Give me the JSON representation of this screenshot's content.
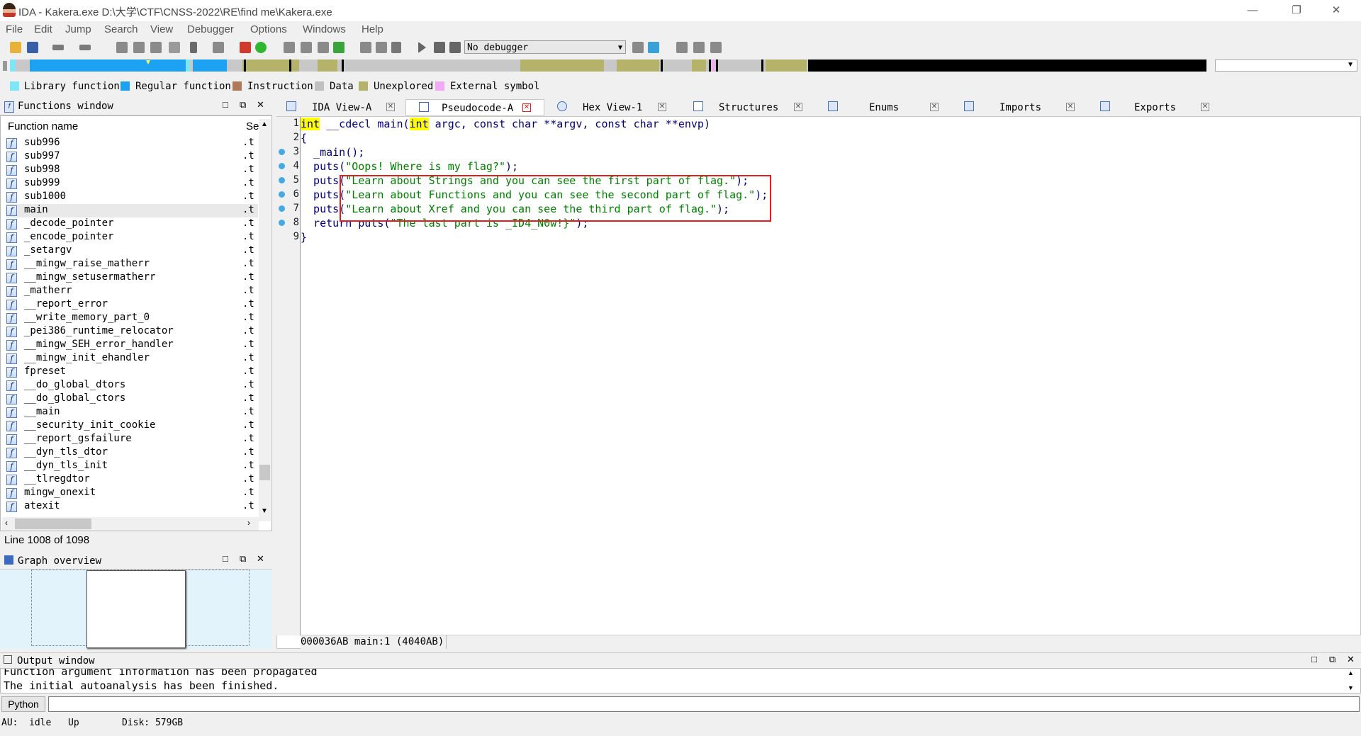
{
  "window": {
    "title": "IDA - Kakera.exe D:\\大学\\CTF\\CNSS-2022\\RE\\find me\\Kakera.exe",
    "minimize": "—",
    "restore": "❐",
    "close": "✕"
  },
  "menu": [
    "File",
    "Edit",
    "Jump",
    "Search",
    "View",
    "Debugger",
    "Options",
    "Windows",
    "Help"
  ],
  "toolbar": {
    "debugger_select": "No debugger"
  },
  "legend": [
    {
      "label": "Library function",
      "color": "#7ee7f7"
    },
    {
      "label": "Regular function",
      "color": "#1da1f2"
    },
    {
      "label": "Instruction",
      "color": "#b07a58"
    },
    {
      "label": "Data",
      "color": "#c0c0c0"
    },
    {
      "label": "Unexplored",
      "color": "#b5b36a"
    },
    {
      "label": "External symbol",
      "color": "#f4a9f4"
    }
  ],
  "functions_window": {
    "title": "Functions window",
    "col_name": "Function name",
    "col_segment": "Se",
    "rows": [
      {
        "name": "sub996",
        "seg": ".t"
      },
      {
        "name": "sub997",
        "seg": ".t"
      },
      {
        "name": "sub998",
        "seg": ".t"
      },
      {
        "name": "sub999",
        "seg": ".t"
      },
      {
        "name": "sub1000",
        "seg": ".t"
      },
      {
        "name": "main",
        "seg": ".t"
      },
      {
        "name": "_decode_pointer",
        "seg": ".t"
      },
      {
        "name": "_encode_pointer",
        "seg": ".t"
      },
      {
        "name": "_setargv",
        "seg": ".t"
      },
      {
        "name": "__mingw_raise_matherr",
        "seg": ".t"
      },
      {
        "name": "__mingw_setusermatherr",
        "seg": ".t"
      },
      {
        "name": "_matherr",
        "seg": ".t"
      },
      {
        "name": "__report_error",
        "seg": ".t"
      },
      {
        "name": "__write_memory_part_0",
        "seg": ".t"
      },
      {
        "name": "_pei386_runtime_relocator",
        "seg": ".t"
      },
      {
        "name": "__mingw_SEH_error_handler",
        "seg": ".t"
      },
      {
        "name": "__mingw_init_ehandler",
        "seg": ".t"
      },
      {
        "name": "fpreset",
        "seg": ".t"
      },
      {
        "name": "__do_global_dtors",
        "seg": ".t"
      },
      {
        "name": "__do_global_ctors",
        "seg": ".t"
      },
      {
        "name": "__main",
        "seg": ".t"
      },
      {
        "name": "__security_init_cookie",
        "seg": ".t"
      },
      {
        "name": "__report_gsfailure",
        "seg": ".t"
      },
      {
        "name": "__dyn_tls_dtor",
        "seg": ".t"
      },
      {
        "name": "__dyn_tls_init",
        "seg": ".t"
      },
      {
        "name": "__tlregdtor",
        "seg": ".t"
      },
      {
        "name": "mingw_onexit",
        "seg": ".t"
      },
      {
        "name": "atexit",
        "seg": ".t"
      }
    ],
    "line_status": "Line 1008 of 1098"
  },
  "graph_overview": {
    "title": "Graph overview"
  },
  "tabs": [
    {
      "label": "IDA View-A"
    },
    {
      "label": "Pseudocode-A"
    },
    {
      "label": "Hex View-1"
    },
    {
      "label": "Structures"
    },
    {
      "label": "Enums"
    },
    {
      "label": "Imports"
    },
    {
      "label": "Exports"
    }
  ],
  "code": {
    "lines": [
      {
        "n": "1",
        "pre": "",
        "kw": "int",
        "mid": " __cdecl main(",
        "kw2": "int",
        "rest": " argc, const char **argv, const char **envp)",
        "str": "",
        "post": ""
      },
      {
        "n": "2",
        "pre": "{",
        "kw": "",
        "mid": "",
        "kw2": "",
        "rest": "",
        "str": "",
        "post": ""
      },
      {
        "n": "3",
        "pre": "  _main();",
        "kw": "",
        "mid": "",
        "kw2": "",
        "rest": "",
        "str": "",
        "post": ""
      },
      {
        "n": "4",
        "pre": "  puts(",
        "kw": "",
        "mid": "",
        "kw2": "",
        "rest": "",
        "str": "\"Oops! Where is my flag?\"",
        "post": ");"
      },
      {
        "n": "5",
        "pre": "  puts(",
        "kw": "",
        "mid": "",
        "kw2": "",
        "rest": "",
        "str": "\"Learn about Strings and you can see the first part of flag.\"",
        "post": ");"
      },
      {
        "n": "6",
        "pre": "  puts(",
        "kw": "",
        "mid": "",
        "kw2": "",
        "rest": "",
        "str": "\"Learn about Functions and you can see the second part of flag.\"",
        "post": ");"
      },
      {
        "n": "7",
        "pre": "  puts(",
        "kw": "",
        "mid": "",
        "kw2": "",
        "rest": "",
        "str": "\"Learn about Xref and you can see the third part of flag.\"",
        "post": ");"
      },
      {
        "n": "8",
        "pre": "  return puts(",
        "kw": "",
        "mid": "",
        "kw2": "",
        "rest": "",
        "str": "\"The last part is _ID4_N0w!}\"",
        "post": ");"
      },
      {
        "n": "9",
        "pre": "}",
        "kw": "",
        "mid": "",
        "kw2": "",
        "rest": "",
        "str": "",
        "post": ""
      }
    ],
    "status": "000036AB main:1 (4040AB)"
  },
  "output_window": {
    "title": "Output window",
    "lines": [
      "Function argument information has been propagated",
      "The initial autoanalysis has been finished."
    ],
    "python_label": "Python"
  },
  "statusbar": {
    "au": "AU:",
    "state": "idle",
    "dir": "Up",
    "disk": "Disk: 579GB"
  }
}
